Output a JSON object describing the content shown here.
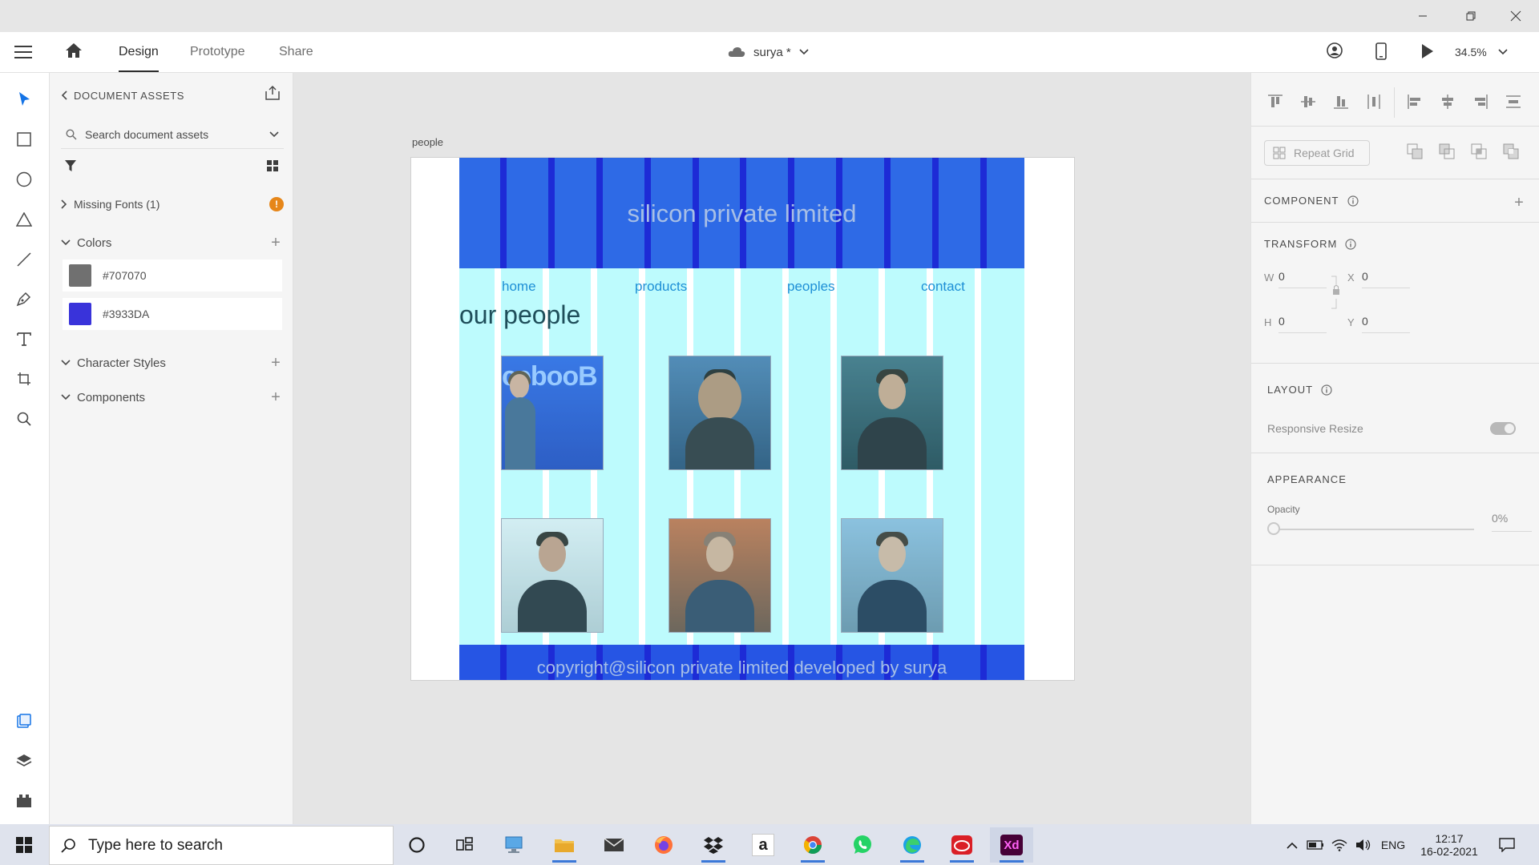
{
  "app": {
    "tabs": [
      "Design",
      "Prototype",
      "Share"
    ],
    "active_tab": "Design",
    "document_name": "surya *",
    "zoom": "34.5%"
  },
  "assets_panel": {
    "title": "DOCUMENT ASSETS",
    "search_placeholder": "Search document assets",
    "missing_fonts": "Missing Fonts (1)",
    "colors_label": "Colors",
    "colors": [
      {
        "hex": "#707070",
        "label": "#707070"
      },
      {
        "hex": "#3933DA",
        "label": "#3933DA"
      }
    ],
    "character_styles_label": "Character Styles",
    "components_label": "Components"
  },
  "artboard": {
    "name": "people",
    "header_title": "silicon private limited",
    "nav": [
      "home",
      "products",
      "peoples",
      "contact"
    ],
    "section_heading": "our people",
    "footer_text": "copyright@silicon private limited developed by surya",
    "photo_text": "cebooB",
    "colors": {
      "header": "#2e6ae6",
      "column_dark": "#1d2bd6",
      "grid_light": "#bdfbfd",
      "footer": "#2655e4"
    }
  },
  "inspector": {
    "repeat_grid": "Repeat Grid",
    "component_title": "COMPONENT",
    "transform_title": "TRANSFORM",
    "w_label": "W",
    "w_value": "0",
    "x_label": "X",
    "x_value": "0",
    "h_label": "H",
    "h_value": "0",
    "y_label": "Y",
    "y_value": "0",
    "layout_title": "LAYOUT",
    "responsive_resize": "Responsive Resize",
    "appearance_title": "APPEARANCE",
    "opacity_label": "Opacity",
    "opacity_value": "0%"
  },
  "taskbar": {
    "search_placeholder": "Type here to search",
    "language": "ENG",
    "time": "12:17",
    "date": "16-02-2021",
    "amazon_glyph": "a",
    "xd_glyph": "Xd"
  }
}
